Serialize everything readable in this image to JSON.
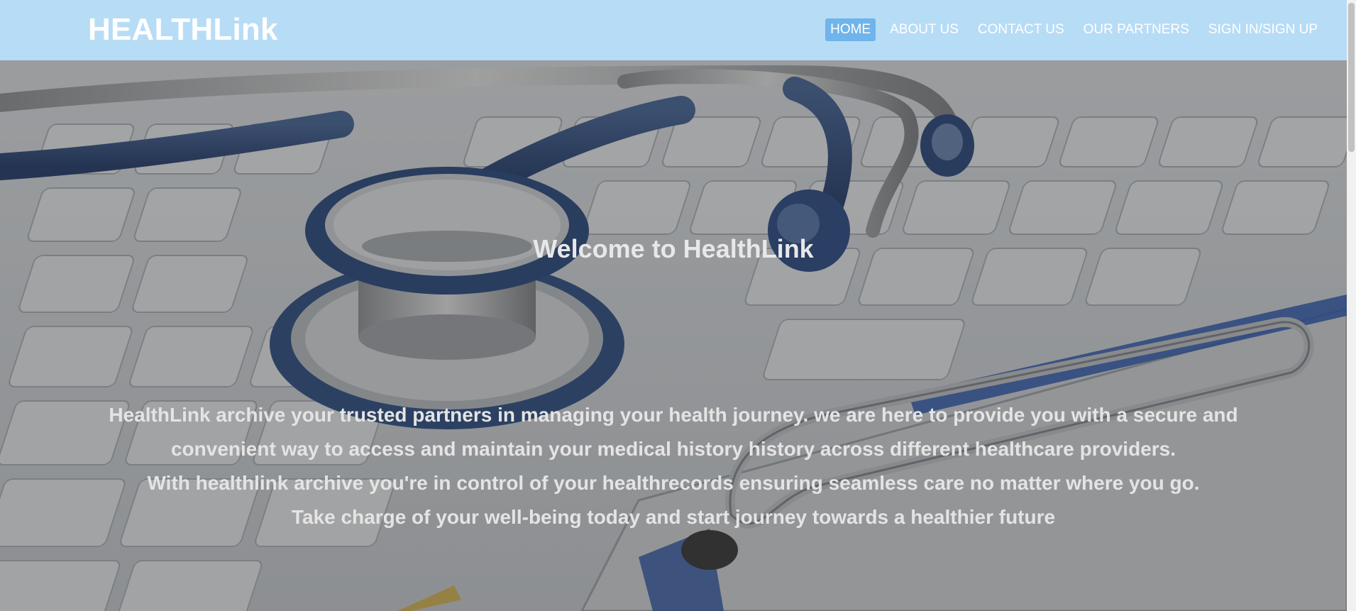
{
  "header": {
    "logo": "HEALTHLink",
    "nav": [
      {
        "label": "HOME",
        "active": true
      },
      {
        "label": "ABOUT US",
        "active": false
      },
      {
        "label": "CONTACT US",
        "active": false
      },
      {
        "label": "OUR PARTNERS",
        "active": false
      },
      {
        "label": "SIGN IN/SIGN UP",
        "active": false
      }
    ]
  },
  "hero": {
    "title": "Welcome to HealthLink",
    "lines": [
      "HealthLink archive your trusted partners in managing your health journey. we are here to provide you with a secure and",
      "convenient way to access and maintain your medical history history across different healthcare providers.",
      "With healthlink archive you're in control of your healthrecords ensuring seamless care no matter where you go.",
      "Take charge of your well-being today and start journey towards a healthier future"
    ],
    "background_image": "stethoscope-on-keyboard"
  },
  "colors": {
    "header_bg": "#b7dcf6",
    "nav_active_bg": "#6fb4ea",
    "text_light": "#ffffff"
  }
}
